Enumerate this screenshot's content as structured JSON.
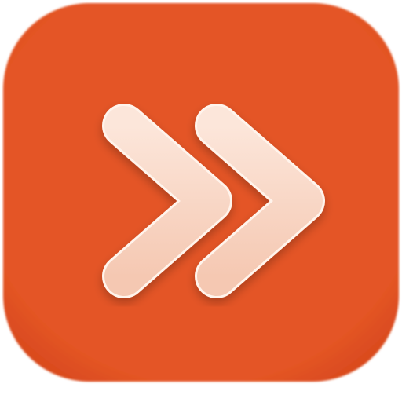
{
  "icon": {
    "name": "double-chevron-right-icon",
    "colors": {
      "background": "#E45525",
      "background_edge": "#D94A1E",
      "glyph_top": "#FCE6DA",
      "glyph_bottom": "#F5C8B2",
      "glyph_outline": "#FFF4EC"
    }
  }
}
